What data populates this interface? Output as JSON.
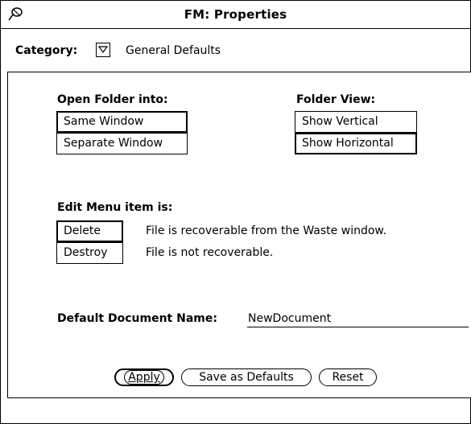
{
  "window": {
    "title": "FM: Properties",
    "pin_icon": "pushpin-icon"
  },
  "category": {
    "label": "Category:",
    "menu_icon": "menu-triangle-icon",
    "value": "General Defaults"
  },
  "open_folder": {
    "heading": "Open Folder into:",
    "options": [
      "Same Window",
      "Separate Window"
    ],
    "selected": "Same Window"
  },
  "folder_view": {
    "heading": "Folder View:",
    "options": [
      "Show Vertical",
      "Show Horizontal"
    ],
    "selected": "Show Horizontal"
  },
  "edit_menu": {
    "heading": "Edit Menu item is:",
    "options": [
      {
        "label": "Delete",
        "description": "File is recoverable from the Waste window."
      },
      {
        "label": "Destroy",
        "description": "File is not recoverable."
      }
    ],
    "selected": "Delete"
  },
  "default_document": {
    "label": "Default Document Name:",
    "value": "NewDocument"
  },
  "buttons": {
    "apply": "Apply",
    "save_defaults": "Save as Defaults",
    "reset": "Reset"
  }
}
